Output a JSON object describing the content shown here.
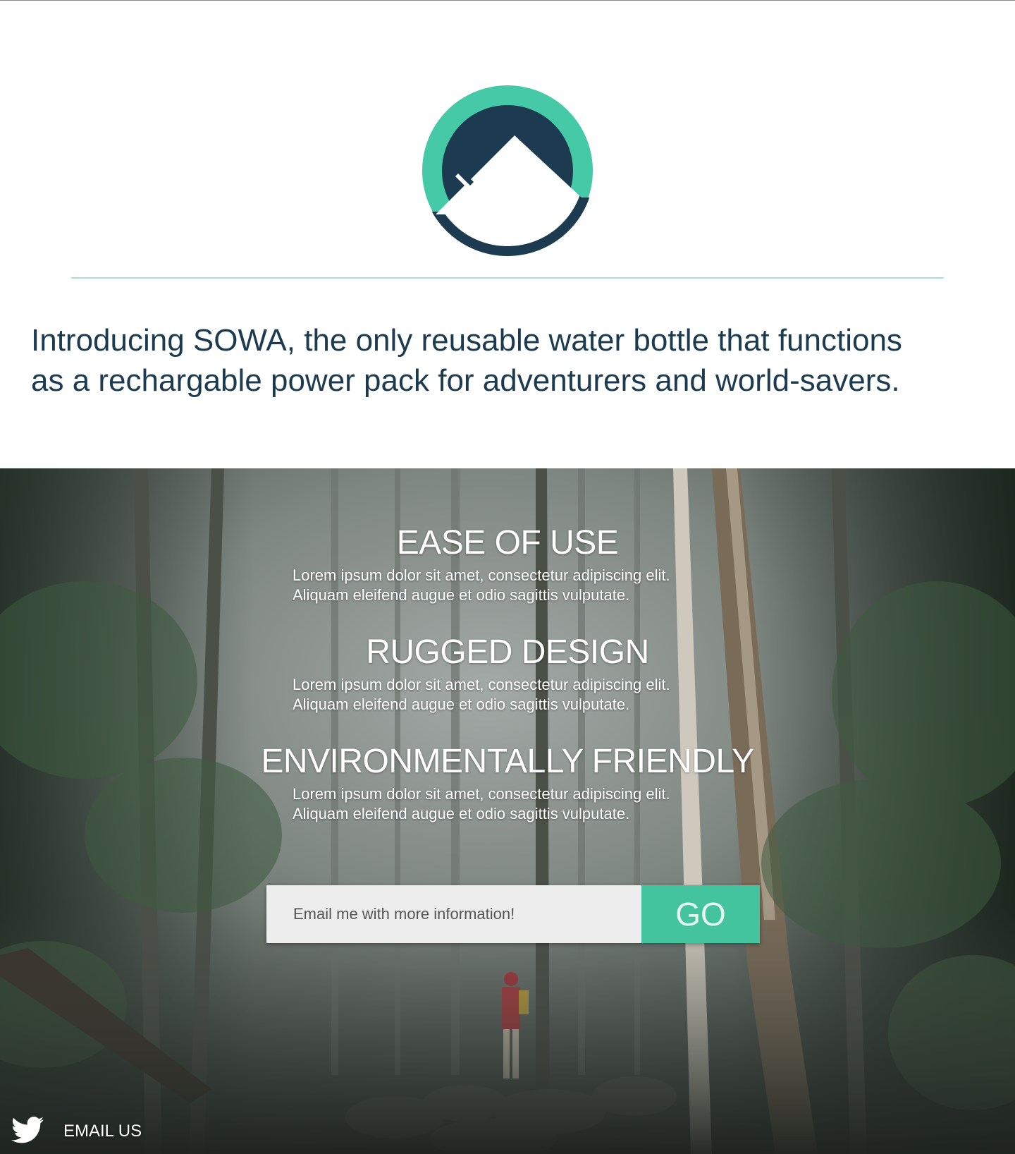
{
  "brand": {
    "logo_icon": "mountain-circle-logo-icon",
    "colors": {
      "teal": "#44c9a5",
      "navy": "#1d3b50",
      "button": "#44c39f",
      "divider": "#a8e3d1"
    }
  },
  "intro": {
    "line1": "Introducing SOWA, the only reusable water bottle that functions",
    "line2": "as a rechargable power pack for adventurers and world-savers."
  },
  "features": [
    {
      "title": "EASE OF USE",
      "body_line1": "Lorem ipsum dolor sit amet, consectetur adipiscing elit.",
      "body_line2": "Aliquam eleifend augue et odio sagittis vulputate."
    },
    {
      "title": "RUGGED DESIGN",
      "body_line1": "Lorem ipsum dolor sit amet, consectetur adipiscing elit.",
      "body_line2": "Aliquam eleifend augue et odio sagittis vulputate."
    },
    {
      "title": "ENVIRONMENTALLY FRIENDLY",
      "body_line1": "Lorem ipsum dolor sit amet, consectetur adipiscing elit.",
      "body_line2": "Aliquam eleifend augue et odio sagittis vulputate."
    }
  ],
  "signup": {
    "placeholder": "Email me with more information!",
    "value": "",
    "button_label": "GO"
  },
  "footer": {
    "twitter_icon": "twitter-bird-icon",
    "email_label": "EMAIL US"
  }
}
